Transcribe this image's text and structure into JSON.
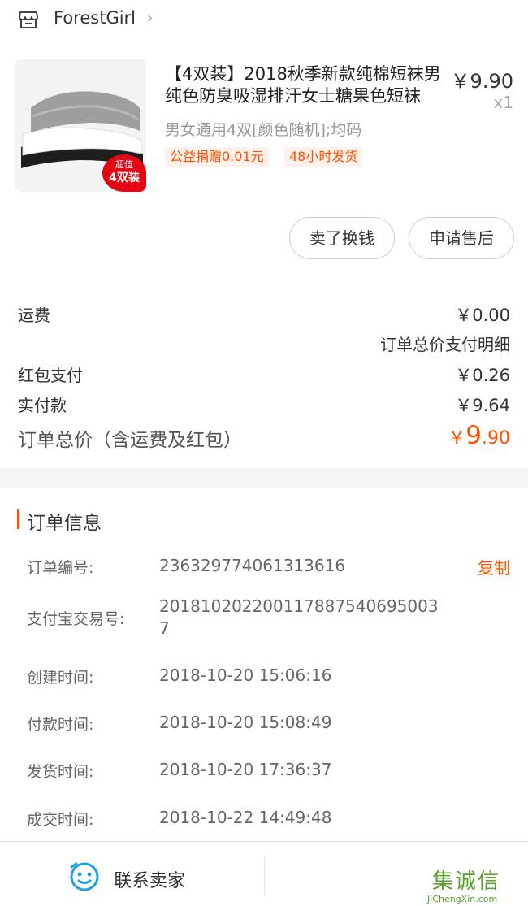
{
  "store": {
    "name": "ForestGirl",
    "arrow": "›"
  },
  "product": {
    "badge_small": "超值",
    "badge_big": "4双装",
    "title": "【4双装】2018秋季新款纯棉短袜男纯色防臭吸湿排汗女士糖果色短袜",
    "price": "￥9.90",
    "qty": "x1",
    "spec": "男女通用4双[颜色随机];均码",
    "tags": [
      "公益捐赠0.01元",
      "48小时发货"
    ]
  },
  "actions": {
    "sell_button": "卖了换钱",
    "aftersale_button": "申请售后"
  },
  "summary": {
    "shipping_label": "运费",
    "shipping_value": "￥0.00",
    "detail_link": "订单总价支付明细",
    "redpacket_label": "红包支付",
    "redpacket_value": "￥0.26",
    "paid_label": "实付款",
    "paid_value": "￥9.64",
    "total_label": "订单总价（含运费及红包）",
    "total_yen": "￥",
    "total_int": "9",
    "total_dec": ".90"
  },
  "order_info": {
    "title": "订单信息",
    "copy_label": "复制",
    "rows": [
      {
        "label": "订单编号:",
        "value": "236329774061313616"
      },
      {
        "label": "支付宝交易号:",
        "value": "2018102022001178875406950037"
      },
      {
        "label": "创建时间:",
        "value": "2018-10-20 15:06:16"
      },
      {
        "label": "付款时间:",
        "value": "2018-10-20 15:08:49"
      },
      {
        "label": "发货时间:",
        "value": "2018-10-20 17:36:37"
      },
      {
        "label": "成交时间:",
        "value": "2018-10-22 14:49:48"
      }
    ]
  },
  "bottom_bar": {
    "contact_label": "联系卖家"
  },
  "watermark": {
    "text": "集诚信",
    "sub": "JiChengXin.com"
  },
  "colors": {
    "accent": "#ff5000",
    "badge": "#e30613",
    "watermark": "#5aa02c"
  }
}
